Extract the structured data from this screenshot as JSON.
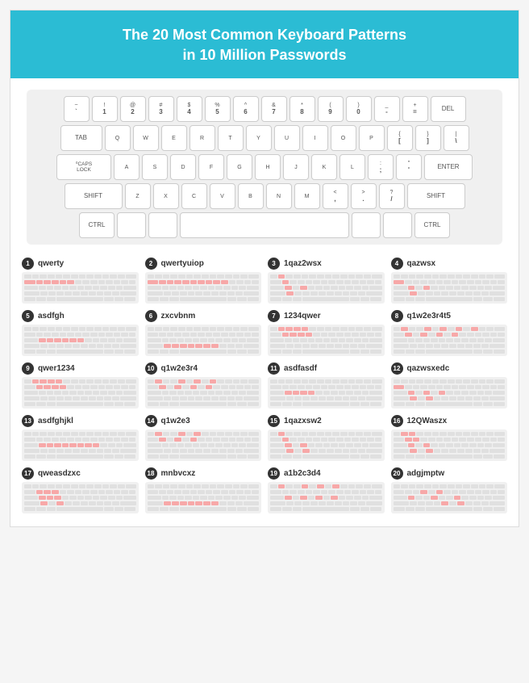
{
  "header": {
    "line1": "The 20 Most Common Keyboard Patterns",
    "line2": "in 10 Million Passwords"
  },
  "keyboard": {
    "rows": [
      [
        "` ~",
        "! 1",
        "@ 2",
        "# 3",
        "$ 4",
        "% 5",
        "^ 6",
        "& 7",
        "* 8",
        "( 9",
        ") 0",
        "_ -",
        "+ =",
        "DEL"
      ],
      [
        "TAB",
        "Q",
        "W",
        "E",
        "R",
        "T",
        "Y",
        "U",
        "I",
        "O",
        "P",
        "{ [",
        "} ]",
        "| \\"
      ],
      [
        "CAPS LOCK",
        "A",
        "S",
        "D",
        "F",
        "G",
        "H",
        "J",
        "K",
        "L",
        ": ;",
        "\" '",
        "ENTER"
      ],
      [
        "SHIFT",
        "Z",
        "X",
        "C",
        "V",
        "B",
        "N",
        "M",
        "< ,",
        "> .",
        "? /",
        "SHIFT"
      ],
      [
        "CTRL",
        "",
        "",
        "SPACE",
        "",
        "",
        "CTRL"
      ]
    ]
  },
  "patterns": [
    {
      "num": 1,
      "name": "qwerty",
      "rows": [
        [
          0,
          0,
          0,
          0,
          0,
          0,
          0,
          0,
          0,
          0,
          0,
          0,
          0
        ],
        [
          1,
          1,
          1,
          1,
          1,
          1,
          0,
          0,
          0,
          0,
          0,
          0,
          0,
          0
        ],
        [
          0,
          0,
          0,
          0,
          0,
          0,
          0,
          0,
          0,
          0,
          0,
          0
        ],
        [
          0,
          0,
          0,
          0,
          0,
          0,
          0,
          0,
          0,
          0,
          0,
          0
        ],
        [
          0,
          0,
          0,
          0,
          0,
          0,
          0
        ]
      ]
    },
    {
      "num": 2,
      "name": "qwertyuiop",
      "rows": [
        [
          0,
          0,
          0,
          0,
          0,
          0,
          0,
          0,
          0,
          0,
          0,
          0,
          0
        ],
        [
          1,
          1,
          1,
          1,
          1,
          1,
          1,
          1,
          1,
          1,
          0,
          0,
          0,
          0
        ],
        [
          0,
          0,
          0,
          0,
          0,
          0,
          0,
          0,
          0,
          0,
          0,
          0
        ],
        [
          0,
          0,
          0,
          0,
          0,
          0,
          0,
          0,
          0,
          0,
          0,
          0
        ],
        [
          0,
          0,
          0,
          0,
          0,
          0,
          0
        ]
      ]
    },
    {
      "num": 3,
      "name": "1qaz2wsx",
      "rows": [
        [
          0,
          1,
          0,
          0,
          0,
          0,
          0,
          0,
          0,
          0,
          0,
          0,
          0
        ],
        [
          0,
          1,
          0,
          0,
          0,
          0,
          0,
          0,
          0,
          0,
          0,
          0,
          0,
          0
        ],
        [
          0,
          1,
          0,
          1,
          0,
          0,
          0,
          0,
          0,
          0,
          0,
          0
        ],
        [
          0,
          1,
          0,
          0,
          0,
          0,
          0,
          0,
          0,
          0,
          0,
          0
        ],
        [
          0,
          0,
          0,
          0,
          0,
          0,
          0
        ]
      ]
    },
    {
      "num": 4,
      "name": "qazwsx",
      "rows": [
        [
          0,
          0,
          0,
          0,
          0,
          0,
          0,
          0,
          0,
          0,
          0,
          0,
          0
        ],
        [
          1,
          0,
          0,
          0,
          0,
          0,
          0,
          0,
          0,
          0,
          0,
          0,
          0,
          0
        ],
        [
          0,
          1,
          0,
          1,
          0,
          0,
          0,
          0,
          0,
          0,
          0,
          0
        ],
        [
          0,
          1,
          0,
          0,
          0,
          0,
          0,
          0,
          0,
          0,
          0,
          0
        ],
        [
          0,
          0,
          0,
          0,
          0,
          0,
          0
        ]
      ]
    },
    {
      "num": 5,
      "name": "asdfgh",
      "rows": [
        [
          0,
          0,
          0,
          0,
          0,
          0,
          0,
          0,
          0,
          0,
          0,
          0,
          0
        ],
        [
          0,
          0,
          0,
          0,
          0,
          0,
          0,
          0,
          0,
          0,
          0,
          0,
          0,
          0
        ],
        [
          0,
          1,
          1,
          1,
          1,
          1,
          1,
          0,
          0,
          0,
          0,
          0
        ],
        [
          0,
          0,
          0,
          0,
          0,
          0,
          0,
          0,
          0,
          0,
          0,
          0
        ],
        [
          0,
          0,
          0,
          0,
          0,
          0,
          0
        ]
      ]
    },
    {
      "num": 6,
      "name": "zxcvbnm",
      "rows": [
        [
          0,
          0,
          0,
          0,
          0,
          0,
          0,
          0,
          0,
          0,
          0,
          0,
          0
        ],
        [
          0,
          0,
          0,
          0,
          0,
          0,
          0,
          0,
          0,
          0,
          0,
          0,
          0,
          0
        ],
        [
          0,
          0,
          0,
          0,
          0,
          0,
          0,
          0,
          0,
          0,
          0,
          0
        ],
        [
          0,
          1,
          1,
          1,
          1,
          1,
          1,
          1,
          0,
          0,
          0,
          0
        ],
        [
          0,
          0,
          0,
          0,
          0,
          0,
          0
        ]
      ]
    },
    {
      "num": 7,
      "name": "1234qwer",
      "rows": [
        [
          0,
          1,
          1,
          1,
          1,
          0,
          0,
          0,
          0,
          0,
          0,
          0,
          0
        ],
        [
          0,
          1,
          1,
          1,
          1,
          0,
          0,
          0,
          0,
          0,
          0,
          0,
          0,
          0
        ],
        [
          0,
          0,
          0,
          0,
          0,
          0,
          0,
          0,
          0,
          0,
          0,
          0
        ],
        [
          0,
          0,
          0,
          0,
          0,
          0,
          0,
          0,
          0,
          0,
          0,
          0
        ],
        [
          0,
          0,
          0,
          0,
          0,
          0,
          0
        ]
      ]
    },
    {
      "num": 8,
      "name": "q1w2e3r4t5",
      "rows": [
        [
          0,
          1,
          0,
          0,
          1,
          0,
          1,
          0,
          1,
          0,
          1,
          0,
          0
        ],
        [
          0,
          1,
          0,
          1,
          0,
          1,
          0,
          1,
          0,
          0,
          0,
          0,
          0,
          0
        ],
        [
          0,
          0,
          0,
          0,
          0,
          0,
          0,
          0,
          0,
          0,
          0,
          0
        ],
        [
          0,
          0,
          0,
          0,
          0,
          0,
          0,
          0,
          0,
          0,
          0,
          0
        ],
        [
          0,
          0,
          0,
          0,
          0,
          0,
          0
        ]
      ]
    },
    {
      "num": 9,
      "name": "qwer1234",
      "rows": [
        [
          0,
          1,
          1,
          1,
          1,
          0,
          0,
          0,
          0,
          0,
          0,
          0,
          0
        ],
        [
          0,
          1,
          1,
          1,
          1,
          0,
          0,
          0,
          0,
          0,
          0,
          0,
          0,
          0
        ],
        [
          0,
          0,
          0,
          0,
          0,
          0,
          0,
          0,
          0,
          0,
          0,
          0
        ],
        [
          0,
          0,
          0,
          0,
          0,
          0,
          0,
          0,
          0,
          0,
          0,
          0
        ],
        [
          0,
          0,
          0,
          0,
          0,
          0,
          0
        ]
      ]
    },
    {
      "num": 10,
      "name": "q1w2e3r4",
      "rows": [
        [
          0,
          1,
          0,
          0,
          1,
          0,
          1,
          0,
          1,
          0,
          0,
          0,
          0
        ],
        [
          0,
          1,
          0,
          1,
          0,
          1,
          0,
          1,
          0,
          0,
          0,
          0,
          0,
          0
        ],
        [
          0,
          0,
          0,
          0,
          0,
          0,
          0,
          0,
          0,
          0,
          0,
          0
        ],
        [
          0,
          0,
          0,
          0,
          0,
          0,
          0,
          0,
          0,
          0,
          0,
          0
        ],
        [
          0,
          0,
          0,
          0,
          0,
          0,
          0
        ]
      ]
    },
    {
      "num": 11,
      "name": "asdfasdf",
      "rows": [
        [
          0,
          0,
          0,
          0,
          0,
          0,
          0,
          0,
          0,
          0,
          0,
          0,
          0
        ],
        [
          0,
          0,
          0,
          0,
          0,
          0,
          0,
          0,
          0,
          0,
          0,
          0,
          0,
          0
        ],
        [
          0,
          1,
          1,
          1,
          1,
          0,
          0,
          0,
          0,
          0,
          0,
          0
        ],
        [
          0,
          0,
          0,
          0,
          0,
          0,
          0,
          0,
          0,
          0,
          0,
          0
        ],
        [
          0,
          0,
          0,
          0,
          0,
          0,
          0
        ]
      ]
    },
    {
      "num": 12,
      "name": "qazwsxedc",
      "rows": [
        [
          0,
          0,
          0,
          0,
          0,
          0,
          0,
          0,
          0,
          0,
          0,
          0,
          0
        ],
        [
          1,
          0,
          0,
          0,
          0,
          0,
          0,
          0,
          0,
          0,
          0,
          0,
          0,
          0
        ],
        [
          0,
          1,
          0,
          1,
          0,
          1,
          0,
          0,
          0,
          0,
          0,
          0
        ],
        [
          0,
          1,
          0,
          1,
          0,
          0,
          0,
          0,
          0,
          0,
          0,
          0
        ],
        [
          0,
          0,
          0,
          0,
          0,
          0,
          0
        ]
      ]
    },
    {
      "num": 13,
      "name": "asdfghjkl",
      "rows": [
        [
          0,
          0,
          0,
          0,
          0,
          0,
          0,
          0,
          0,
          0,
          0,
          0,
          0
        ],
        [
          0,
          0,
          0,
          0,
          0,
          0,
          0,
          0,
          0,
          0,
          0,
          0,
          0,
          0
        ],
        [
          0,
          1,
          1,
          1,
          1,
          1,
          1,
          1,
          1,
          0,
          0,
          0
        ],
        [
          0,
          0,
          0,
          0,
          0,
          0,
          0,
          0,
          0,
          0,
          0,
          0
        ],
        [
          0,
          0,
          0,
          0,
          0,
          0,
          0
        ]
      ]
    },
    {
      "num": 14,
      "name": "q1w2e3",
      "rows": [
        [
          0,
          1,
          0,
          0,
          1,
          0,
          1,
          0,
          0,
          0,
          0,
          0,
          0
        ],
        [
          0,
          1,
          0,
          1,
          0,
          1,
          0,
          0,
          0,
          0,
          0,
          0,
          0,
          0
        ],
        [
          0,
          0,
          0,
          0,
          0,
          0,
          0,
          0,
          0,
          0,
          0,
          0
        ],
        [
          0,
          0,
          0,
          0,
          0,
          0,
          0,
          0,
          0,
          0,
          0,
          0
        ],
        [
          0,
          0,
          0,
          0,
          0,
          0,
          0
        ]
      ]
    },
    {
      "num": 15,
      "name": "1qazxsw2",
      "rows": [
        [
          0,
          1,
          0,
          0,
          0,
          0,
          0,
          0,
          0,
          0,
          0,
          0,
          0
        ],
        [
          0,
          1,
          0,
          0,
          0,
          0,
          0,
          0,
          0,
          0,
          0,
          0,
          0,
          0
        ],
        [
          0,
          1,
          0,
          1,
          0,
          0,
          0,
          0,
          0,
          0,
          0,
          0
        ],
        [
          0,
          1,
          0,
          1,
          0,
          0,
          0,
          0,
          0,
          0,
          0,
          0
        ],
        [
          0,
          0,
          0,
          0,
          0,
          0,
          0
        ]
      ]
    },
    {
      "num": 16,
      "name": "12QWaszx",
      "rows": [
        [
          0,
          1,
          1,
          0,
          0,
          0,
          0,
          0,
          0,
          0,
          0,
          0,
          0
        ],
        [
          0,
          1,
          1,
          0,
          0,
          0,
          0,
          0,
          0,
          0,
          0,
          0,
          0,
          0
        ],
        [
          0,
          1,
          0,
          1,
          0,
          0,
          0,
          0,
          0,
          0,
          0,
          0
        ],
        [
          0,
          1,
          0,
          1,
          0,
          0,
          0,
          0,
          0,
          0,
          0,
          0
        ],
        [
          0,
          0,
          0,
          0,
          0,
          0,
          0
        ]
      ]
    },
    {
      "num": 17,
      "name": "qweasdzxc",
      "rows": [
        [
          0,
          0,
          0,
          0,
          0,
          0,
          0,
          0,
          0,
          0,
          0,
          0,
          0
        ],
        [
          0,
          1,
          1,
          1,
          0,
          0,
          0,
          0,
          0,
          0,
          0,
          0,
          0,
          0
        ],
        [
          0,
          1,
          1,
          1,
          0,
          0,
          0,
          0,
          0,
          0,
          0,
          0
        ],
        [
          0,
          1,
          0,
          1,
          0,
          0,
          0,
          0,
          0,
          0,
          0,
          0
        ],
        [
          0,
          0,
          0,
          0,
          0,
          0,
          0
        ]
      ]
    },
    {
      "num": 18,
      "name": "mnbvcxz",
      "rows": [
        [
          0,
          0,
          0,
          0,
          0,
          0,
          0,
          0,
          0,
          0,
          0,
          0,
          0
        ],
        [
          0,
          0,
          0,
          0,
          0,
          0,
          0,
          0,
          0,
          0,
          0,
          0,
          0,
          0
        ],
        [
          0,
          0,
          0,
          0,
          0,
          0,
          0,
          0,
          0,
          0,
          0,
          0
        ],
        [
          0,
          1,
          1,
          1,
          1,
          1,
          1,
          1,
          0,
          0,
          0,
          0
        ],
        [
          0,
          0,
          0,
          0,
          0,
          0,
          0
        ]
      ]
    },
    {
      "num": 19,
      "name": "a1b2c3d4",
      "rows": [
        [
          0,
          1,
          0,
          0,
          1,
          0,
          1,
          0,
          1,
          0,
          0,
          0,
          0
        ],
        [
          0,
          0,
          0,
          0,
          0,
          0,
          0,
          0,
          0,
          0,
          0,
          0,
          0,
          0
        ],
        [
          0,
          1,
          0,
          1,
          0,
          1,
          0,
          1,
          0,
          0,
          0,
          0
        ],
        [
          0,
          0,
          0,
          0,
          0,
          0,
          0,
          0,
          0,
          0,
          0,
          0
        ],
        [
          0,
          0,
          0,
          0,
          0,
          0,
          0
        ]
      ]
    },
    {
      "num": 20,
      "name": "adgjmptw",
      "rows": [
        [
          0,
          0,
          0,
          0,
          0,
          0,
          0,
          0,
          0,
          0,
          0,
          0,
          0
        ],
        [
          0,
          0,
          0,
          1,
          0,
          1,
          0,
          0,
          0,
          0,
          0,
          0,
          0,
          0
        ],
        [
          0,
          1,
          0,
          0,
          1,
          0,
          0,
          1,
          0,
          0,
          0,
          0
        ],
        [
          0,
          0,
          0,
          0,
          0,
          1,
          0,
          1,
          0,
          0,
          0,
          0
        ],
        [
          0,
          0,
          0,
          0,
          0,
          0,
          0
        ]
      ]
    }
  ]
}
